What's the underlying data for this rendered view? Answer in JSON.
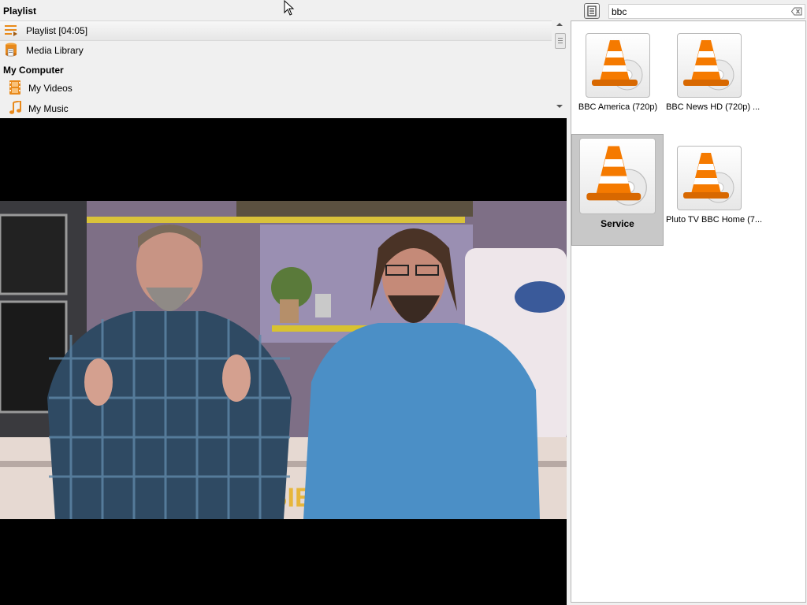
{
  "sidebar": {
    "playlist_header": "Playlist",
    "items_top": [
      {
        "label": "Playlist [04:05]",
        "icon": "playlist-icon"
      },
      {
        "label": "Media Library",
        "icon": "media-library-icon"
      }
    ],
    "my_computer_header": "My Computer",
    "items_computer": [
      {
        "label": "My Videos",
        "icon": "film-icon"
      },
      {
        "label": "My Music",
        "icon": "music-note-icon"
      }
    ]
  },
  "search": {
    "value": "bbc",
    "clear_icon": "clear-search-icon"
  },
  "results": [
    {
      "label": "BBC America (720p)",
      "icon": "vlc-cone-disc-icon"
    },
    {
      "label": "BBC News HD (720p) ...",
      "icon": "vlc-cone-disc-icon"
    },
    {
      "label": "Service",
      "icon": "vlc-cone-disc-icon",
      "selected": true
    },
    {
      "label": "Pluto TV BBC Home (7...",
      "icon": "vlc-cone-disc-icon"
    }
  ],
  "colors": {
    "accent_orange": "#f57a00",
    "selected_tile": "#c8c8c8",
    "video_bg": "#000000"
  }
}
